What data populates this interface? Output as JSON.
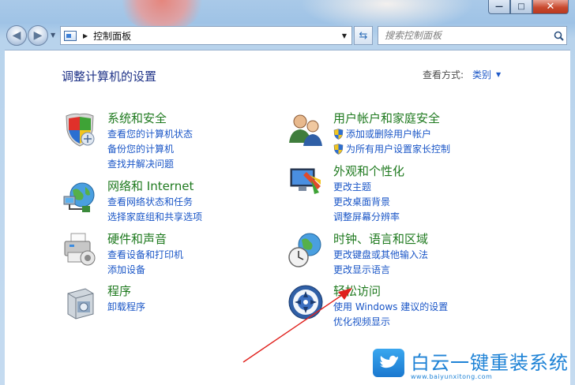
{
  "window": {
    "caption_min": "—",
    "caption_max": "□",
    "caption_close": "✕"
  },
  "nav": {
    "back_glyph": "◀",
    "forward_glyph": "▶",
    "dropdown_glyph": "▼",
    "address_sep": "▶",
    "address_text": "控制面板",
    "address_drop": "▼",
    "refresh_glyph": "⇆",
    "search_placeholder": "搜索控制面板",
    "search_icon": "search-icon"
  },
  "header": {
    "title": "调整计算机的设置",
    "viewby_label": "查看方式:",
    "viewby_value": "类别",
    "viewby_arrow": "▼"
  },
  "categories": [
    {
      "id": "system-security",
      "title": "系统和安全",
      "icon": "shield-icon",
      "links": [
        "查看您的计算机状态",
        "备份您的计算机",
        "查找并解决问题"
      ]
    },
    {
      "id": "network",
      "title": "网络和 Internet",
      "icon": "network-globe-icon",
      "links": [
        "查看网络状态和任务",
        "选择家庭组和共享选项"
      ]
    },
    {
      "id": "hardware",
      "title": "硬件和声音",
      "icon": "printer-icon",
      "links": [
        "查看设备和打印机",
        "添加设备"
      ]
    },
    {
      "id": "programs",
      "title": "程序",
      "icon": "programs-box-icon",
      "links": [
        "卸载程序"
      ]
    },
    {
      "id": "user-accounts",
      "title": "用户帐户和家庭安全",
      "icon": "users-icon",
      "links": [
        "添加或删除用户帐户",
        "为所有用户设置家长控制"
      ]
    },
    {
      "id": "appearance",
      "title": "外观和个性化",
      "icon": "monitor-paint-icon",
      "links": [
        "更改主题",
        "更改桌面背景",
        "调整屏幕分辨率"
      ]
    },
    {
      "id": "clock-region",
      "title": "时钟、语言和区域",
      "icon": "clock-globe-icon",
      "links": [
        "更改键盘或其他输入法",
        "更改显示语言"
      ]
    },
    {
      "id": "ease-of-access",
      "title": "轻松访问",
      "icon": "ease-of-access-icon",
      "links": [
        "使用 Windows 建议的设置",
        "优化视频显示"
      ]
    }
  ],
  "watermark": {
    "text": "白云一键重装系统",
    "url": "www.baiyunxitong.com"
  },
  "colors": {
    "title_blue": "#1e3287",
    "category_green": "#1f7a1f",
    "link_blue": "#1a56c7",
    "annotation_red": "#e0201c",
    "watermark_blue": "#1f83d6"
  }
}
